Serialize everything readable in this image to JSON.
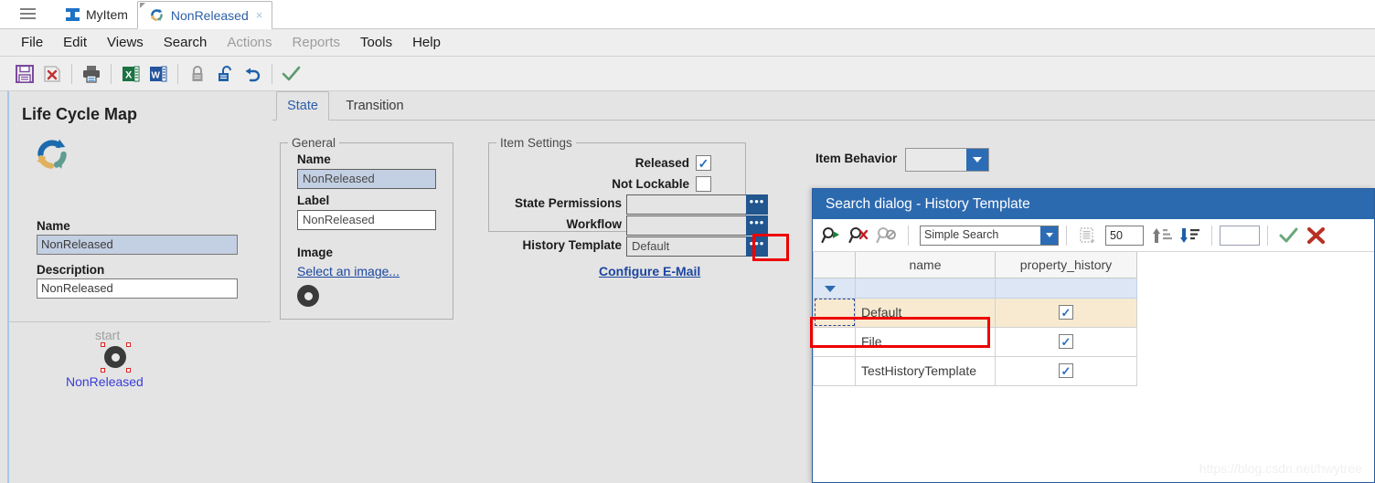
{
  "window": {
    "tabs": [
      {
        "label": "MyItem",
        "icon": "ibeam-icon",
        "active": false
      },
      {
        "label": "NonReleased",
        "icon": "lifecycle-refresh-icon",
        "active": true,
        "close": "×"
      }
    ],
    "hamburger": "menu-icon"
  },
  "menubar": {
    "items": [
      {
        "label": "File",
        "disabled": false
      },
      {
        "label": "Edit",
        "disabled": false
      },
      {
        "label": "Views",
        "disabled": false
      },
      {
        "label": "Search",
        "disabled": false
      },
      {
        "label": "Actions",
        "disabled": true
      },
      {
        "label": "Reports",
        "disabled": true
      },
      {
        "label": "Tools",
        "disabled": false
      },
      {
        "label": "Help",
        "disabled": false
      }
    ]
  },
  "toolbar": {
    "buttons": [
      {
        "name": "save-icon"
      },
      {
        "name": "delete-icon"
      },
      {
        "name": "print-icon"
      },
      {
        "name": "export-excel-icon"
      },
      {
        "name": "export-word-icon"
      },
      {
        "name": "lock-icon"
      },
      {
        "name": "unlock-icon"
      },
      {
        "name": "undo-icon"
      },
      {
        "name": "apply-check-icon"
      }
    ]
  },
  "left_panel": {
    "title": "Life Cycle Map",
    "icon": "lifecycle-refresh-icon",
    "name_label": "Name",
    "name_value": "NonReleased",
    "description_label": "Description",
    "description_value": "NonReleased",
    "graph": {
      "start_label": "start",
      "node_label": "NonReleased"
    }
  },
  "content": {
    "tabs": [
      {
        "label": "State",
        "active": true
      },
      {
        "label": "Transition",
        "active": false
      }
    ],
    "general": {
      "legend": "General",
      "name_label": "Name",
      "name_value": "NonReleased",
      "label_label": "Label",
      "label_value": "NonReleased",
      "image_label": "Image",
      "select_image_link": "Select an image..."
    },
    "item_settings": {
      "legend": "Item Settings",
      "released_label": "Released",
      "released_checked": true,
      "not_lockable_label": "Not Lockable",
      "not_lockable_checked": false,
      "state_permissions_label": "State Permissions",
      "state_permissions_value": "",
      "workflow_label": "Workflow",
      "workflow_value": "",
      "history_template_label": "History Template",
      "history_template_value": "Default",
      "ellipsis": "•••",
      "configure_email_link": "Configure E-Mail"
    },
    "item_behavior": {
      "label": "Item Behavior",
      "value": ""
    }
  },
  "dialog": {
    "title": "Search dialog - History Template",
    "toolbar": {
      "run_search_icon": "search-run-icon",
      "clear_search_icon": "search-clear-icon",
      "disabled_search_icon": "search-disabled-icon",
      "mode_value": "Simple Search",
      "page_icon": "page-add-icon",
      "max_rows": "50",
      "sort_asc_icon": "sort-ascending-icon",
      "sort_desc_icon": "sort-descending-icon",
      "blank_field": "",
      "confirm_icon": "check-icon",
      "cancel_icon": "cross-icon"
    },
    "table": {
      "columns": [
        "",
        "name",
        "property_history"
      ],
      "filter_row": {
        "arrow": "filter-dropdown-icon",
        "name": "",
        "property_history": ""
      },
      "rows": [
        {
          "name": "Default",
          "property_history": true,
          "selected": true
        },
        {
          "name": "File",
          "property_history": true,
          "selected": false
        },
        {
          "name": "TestHistoryTemplate",
          "property_history": true,
          "selected": false
        }
      ],
      "check_glyph": "✓"
    }
  },
  "watermark": "https://blog.csdn.net/hwytree",
  "colors": {
    "accent_blue": "#2c6ab0",
    "highlight_red": "#ee0000",
    "selection_blue": "#c3cfe2",
    "row_selected": "#f7ead0",
    "filter_row": "#dce6f4",
    "link_blue": "#1b46a0",
    "panel_bg": "#e4e4e4"
  }
}
